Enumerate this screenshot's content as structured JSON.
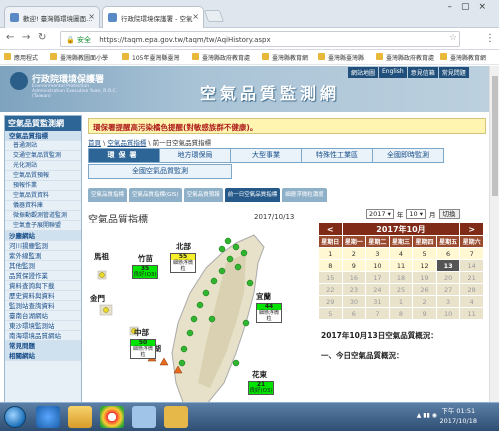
{
  "browser": {
    "tabs": [
      {
        "label": "歡迎! 臺灣縣環境圖面..."
      },
      {
        "label": "行政院環境保護署 - 空氣"
      }
    ],
    "url": "https://taqm.epa.gov.tw/taqm/tw/AqiHistory.aspx",
    "secure_label": "安全",
    "bookmarks": [
      "應用程式",
      "臺灣縣教圖面小學",
      "105年臺灣縣臺灣",
      "臺灣縣政府教育處",
      "臺灣縣教育網",
      "臺灣縣臺灣縣",
      "臺灣縣政府教育處",
      "臺灣縣教育網"
    ]
  },
  "site": {
    "org_name": "行政院環境保護署",
    "org_en": "Environmental Protection Administration Executive Yuan, R.O.C. (Taiwan)",
    "title": "空氣品質監測網",
    "top_links": [
      "網站地圖",
      "English",
      "意見信箱",
      "常見問題"
    ]
  },
  "sidebar": {
    "heading": "空氣品質監測網",
    "items": [
      {
        "label": "空氣品質指標",
        "type": "grp"
      },
      {
        "label": "普通測站",
        "type": "sub"
      },
      {
        "label": "交通空氣品質監測",
        "type": "sub"
      },
      {
        "label": "光化測站",
        "type": "sub"
      },
      {
        "label": "空氣品質預報",
        "type": "sub"
      },
      {
        "label": "預報作業",
        "type": "sub"
      },
      {
        "label": "空氣品質資料",
        "type": "sub"
      },
      {
        "label": "儀器資料庫",
        "type": "sub"
      },
      {
        "label": "微振動觀測管道監測",
        "type": "sub"
      },
      {
        "label": "空氣盒子展開聯盟",
        "type": "sub"
      },
      {
        "label": "沙塵網站",
        "type": "grp"
      },
      {
        "label": "河川揚塵監測",
        "type": ""
      },
      {
        "label": "紫外線監測",
        "type": ""
      },
      {
        "label": "其他監測",
        "type": ""
      },
      {
        "label": "品質保證作業",
        "type": ""
      },
      {
        "label": "資料查詢與下載",
        "type": ""
      },
      {
        "label": "歷史資料與資料",
        "type": ""
      },
      {
        "label": "監測站查詢資料",
        "type": ""
      },
      {
        "label": "臺南台湖網站",
        "type": ""
      },
      {
        "label": "東沙環境監測站",
        "type": ""
      },
      {
        "label": "南海環境品質網站",
        "type": ""
      },
      {
        "label": "常見問題",
        "type": "grp"
      },
      {
        "label": "相關網站",
        "type": "grp"
      }
    ]
  },
  "main": {
    "notice": "環保署提醒高污染橘色提醒(對敏感族群不健康)。",
    "breadcrumb": [
      "首頁",
      "空氣品質指標",
      "前一日空氣品質指標"
    ],
    "nav_row1": [
      {
        "label": "環保署",
        "active": true
      },
      {
        "label": "地方環保局",
        "active": false
      },
      {
        "label": "大型事業",
        "active": false
      },
      {
        "label": "特殊性工業區",
        "active": false
      },
      {
        "label": "全國即時監測",
        "active": false
      }
    ],
    "nav_row2": [
      {
        "label": "全國空氣品質監測",
        "active": false
      }
    ],
    "subtabs": [
      {
        "label": "空氣品質指標",
        "active": false
      },
      {
        "label": "空氣品質指標(GIS)",
        "active": false
      },
      {
        "label": "空氣品質預報",
        "active": false
      },
      {
        "label": "前一日空氣品質指標",
        "active": true
      },
      {
        "label": "細懸浮微粒濃度",
        "active": false
      }
    ],
    "content_title": "空氣品質指標",
    "date": "2017/10/13",
    "regions": [
      {
        "name": "竹苗",
        "aqi": "35",
        "status": "良好(O3)",
        "color": "g"
      },
      {
        "name": "北部",
        "aqi": "55",
        "status": "細懸浮微粒",
        "color": "y"
      },
      {
        "name": "宜蘭",
        "aqi": "44",
        "status": "細懸浮微粒",
        "color": "g"
      },
      {
        "name": "中部",
        "aqi": "50",
        "status": "細懸浮微粒",
        "color": "g"
      },
      {
        "name": "花東",
        "aqi": "21",
        "status": "良好(O3)",
        "color": "g"
      }
    ],
    "offshore": [
      "馬祖",
      "金門",
      "澎湖"
    ],
    "calendar": {
      "year_sel": "2017",
      "month_sel": "10",
      "year_unit": "年",
      "month_unit": "月",
      "switch_btn": "切換",
      "prev": "<",
      "next": ">",
      "title": "2017年10月",
      "weekdays": [
        "星期日",
        "星期一",
        "星期二",
        "星期三",
        "星期四",
        "星期五",
        "星期六"
      ],
      "weeks": [
        [
          {
            "d": "1",
            "c": ""
          },
          {
            "d": "2",
            "c": ""
          },
          {
            "d": "3",
            "c": ""
          },
          {
            "d": "4",
            "c": ""
          },
          {
            "d": "5",
            "c": ""
          },
          {
            "d": "6",
            "c": ""
          },
          {
            "d": "7",
            "c": ""
          }
        ],
        [
          {
            "d": "8",
            "c": ""
          },
          {
            "d": "9",
            "c": ""
          },
          {
            "d": "10",
            "c": ""
          },
          {
            "d": "11",
            "c": ""
          },
          {
            "d": "12",
            "c": ""
          },
          {
            "d": "13",
            "c": "sel13"
          },
          {
            "d": "14",
            "c": "other"
          }
        ],
        [
          {
            "d": "15",
            "c": "other"
          },
          {
            "d": "16",
            "c": "other"
          },
          {
            "d": "17",
            "c": "other"
          },
          {
            "d": "18",
            "c": "other"
          },
          {
            "d": "19",
            "c": "other"
          },
          {
            "d": "20",
            "c": "other"
          },
          {
            "d": "21",
            "c": "other"
          }
        ],
        [
          {
            "d": "22",
            "c": "other"
          },
          {
            "d": "23",
            "c": "other"
          },
          {
            "d": "24",
            "c": "other"
          },
          {
            "d": "25",
            "c": "other"
          },
          {
            "d": "26",
            "c": "other"
          },
          {
            "d": "27",
            "c": "other"
          },
          {
            "d": "28",
            "c": "other"
          }
        ],
        [
          {
            "d": "29",
            "c": "other"
          },
          {
            "d": "30",
            "c": "other"
          },
          {
            "d": "31",
            "c": "other"
          },
          {
            "d": "1",
            "c": "other"
          },
          {
            "d": "2",
            "c": "other"
          },
          {
            "d": "3",
            "c": "other"
          },
          {
            "d": "4",
            "c": "other"
          }
        ],
        [
          {
            "d": "5",
            "c": "other"
          },
          {
            "d": "6",
            "c": "other"
          },
          {
            "d": "7",
            "c": "other"
          },
          {
            "d": "8",
            "c": "other"
          },
          {
            "d": "9",
            "c": "other"
          },
          {
            "d": "10",
            "c": "other"
          },
          {
            "d": "11",
            "c": "other"
          }
        ]
      ]
    },
    "quality_title": "2017年10月13日空氣品質概況：",
    "quality_sub": "一、今日空氣品質概況："
  },
  "taskbar": {
    "time": "下午 01:51",
    "date": "2017/10/18"
  },
  "colors": {
    "good": "#00e400",
    "moderate": "#f5ef2a",
    "calendar_header": "#7f2b17",
    "nav_active": "#2d6596"
  }
}
